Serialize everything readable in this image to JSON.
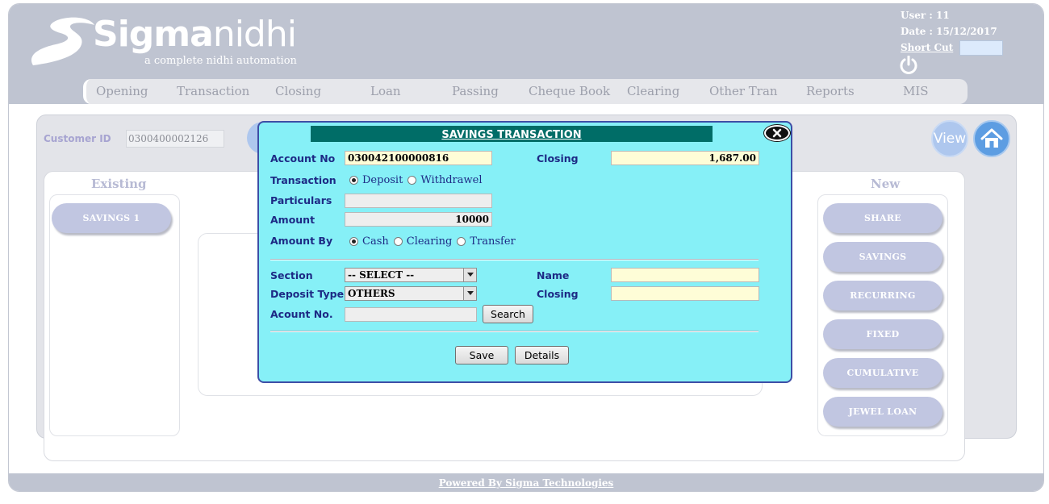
{
  "brand": {
    "name_bold": "Sigma",
    "name_light": "nidhi",
    "tagline": "a complete nidhi automation"
  },
  "user": {
    "user_line": "User : 11",
    "date_line": "Date : 15/12/2017",
    "shortcut_label": "Short Cut",
    "shortcut_value": ""
  },
  "menu": [
    {
      "label": "Opening"
    },
    {
      "label": "Transaction"
    },
    {
      "label": "Closing"
    },
    {
      "label": "Loan"
    },
    {
      "label": "Passing"
    },
    {
      "label": "Cheque Book"
    },
    {
      "label": "Clearing"
    },
    {
      "label": "Other Tran"
    },
    {
      "label": "Reports"
    },
    {
      "label": "MIS"
    }
  ],
  "customer": {
    "label": "Customer ID",
    "value": "0300400002126"
  },
  "actions": {
    "view_label": "View"
  },
  "existing": {
    "title": "Existing",
    "items": [
      {
        "label": "SAVINGS 1"
      }
    ]
  },
  "new": {
    "title": "New",
    "items": [
      {
        "label": "SHARE"
      },
      {
        "label": "SAVINGS"
      },
      {
        "label": "RECURRING"
      },
      {
        "label": "FIXED"
      },
      {
        "label": "CUMULATIVE"
      },
      {
        "label": "JEWEL LOAN"
      }
    ]
  },
  "modal": {
    "title": "SAVINGS TRANSACTION",
    "account_no_label": "Account No",
    "account_no_value": "030042100000816",
    "closing_label": "Closing",
    "closing_value": "1,687.00",
    "transaction_label": "Transaction",
    "transaction_options": [
      {
        "label": "Deposit",
        "selected": true
      },
      {
        "label": "Withdrawel",
        "selected": false
      }
    ],
    "particulars_label": "Particulars",
    "particulars_value": "",
    "amount_label": "Amount",
    "amount_value": "10000",
    "amount_by_label": "Amount By",
    "amount_by_options": [
      {
        "label": "Cash",
        "selected": true
      },
      {
        "label": "Clearing",
        "selected": false
      },
      {
        "label": "Transfer",
        "selected": false
      }
    ],
    "section_label": "Section",
    "section_value": "-- SELECT --",
    "name_label": "Name",
    "name_value": "",
    "deposit_type_label": "Deposit Type",
    "deposit_type_value": "OTHERS",
    "closing2_label": "Closing",
    "closing2_value": "",
    "acount_no_label": "Acount No.",
    "acount_no_value": "",
    "search_label": "Search",
    "save_label": "Save",
    "details_label": "Details"
  },
  "footer": {
    "text": "Powered By Sigma Technologies"
  },
  "colors": {
    "header_bg": "#bfc4d1",
    "modal_bg": "#86f0f7",
    "modal_title_bg": "#006d67",
    "label_color": "#1d2a85"
  }
}
